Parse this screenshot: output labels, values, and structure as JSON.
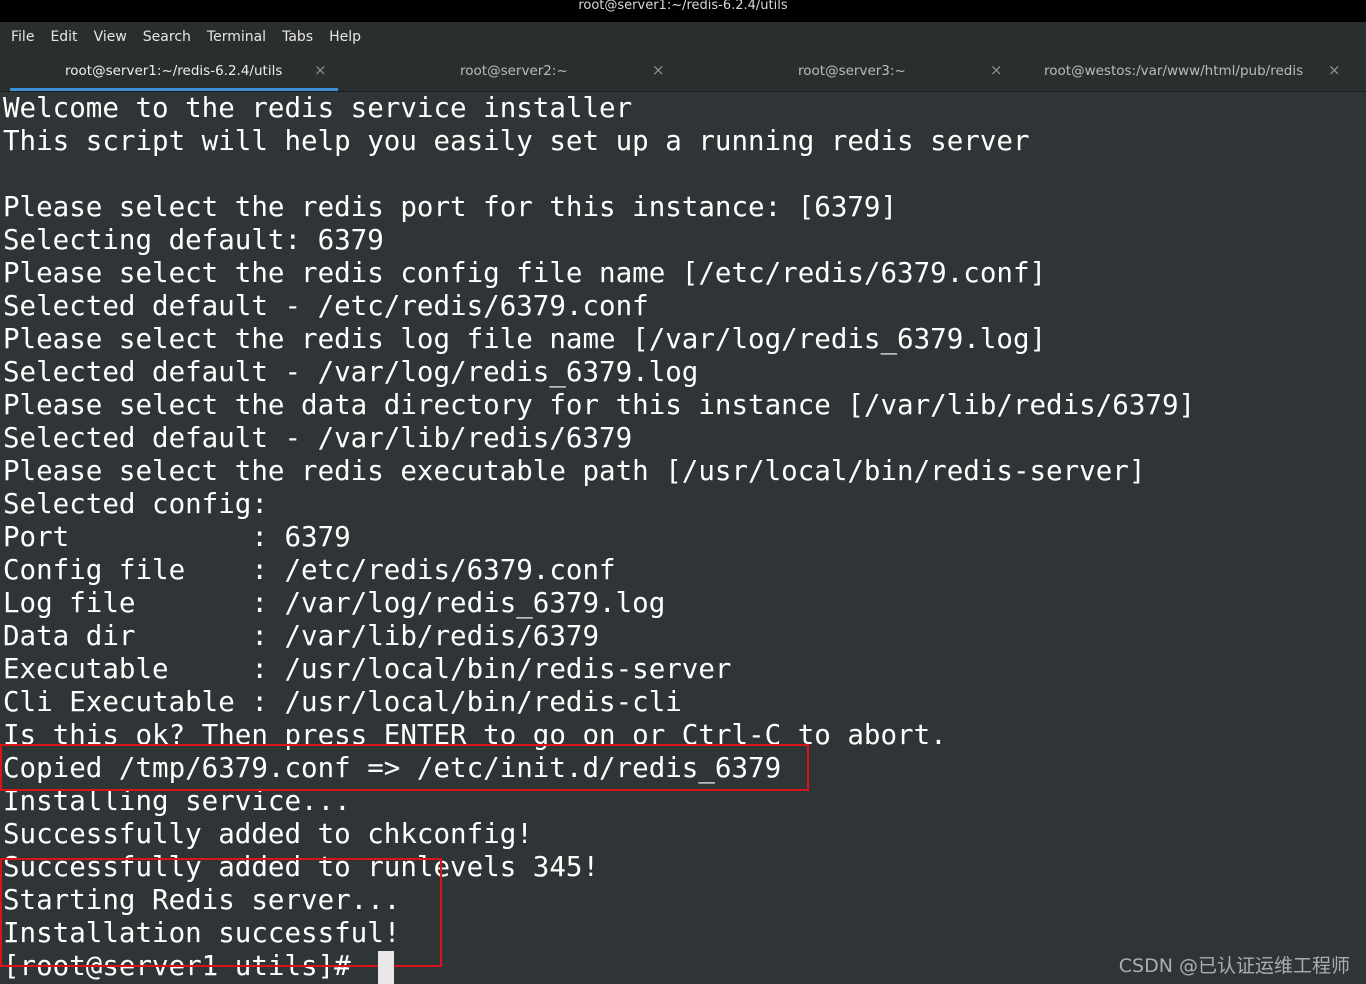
{
  "window": {
    "title": "root@server1:~/redis-6.2.4/utils"
  },
  "menu": [
    "File",
    "Edit",
    "View",
    "Search",
    "Terminal",
    "Tabs",
    "Help"
  ],
  "tabs": [
    {
      "label": "root@server1:~/redis-6.2.4/utils",
      "close": "×",
      "active": true
    },
    {
      "label": "root@server2:~",
      "close": "×",
      "active": false
    },
    {
      "label": "root@server3:~",
      "close": "×",
      "active": false
    },
    {
      "label": "root@westos:/var/www/html/pub/redis",
      "close": "×",
      "active": false
    }
  ],
  "terminal": {
    "lines": [
      "Welcome to the redis service installer",
      "This script will help you easily set up a running redis server",
      "",
      "Please select the redis port for this instance: [6379]",
      "Selecting default: 6379",
      "Please select the redis config file name [/etc/redis/6379.conf]",
      "Selected default - /etc/redis/6379.conf",
      "Please select the redis log file name [/var/log/redis_6379.log]",
      "Selected default - /var/log/redis_6379.log",
      "Please select the data directory for this instance [/var/lib/redis/6379]",
      "Selected default - /var/lib/redis/6379",
      "Please select the redis executable path [/usr/local/bin/redis-server]",
      "Selected config:",
      "Port           : 6379",
      "Config file    : /etc/redis/6379.conf",
      "Log file       : /var/log/redis_6379.log",
      "Data dir       : /var/lib/redis/6379",
      "Executable     : /usr/local/bin/redis-server",
      "Cli Executable : /usr/local/bin/redis-cli",
      "Is this ok? Then press ENTER to go on or Ctrl-C to abort.",
      "Copied /tmp/6379.conf => /etc/init.d/redis_6379",
      "Installing service...",
      "Successfully added to chkconfig!",
      "Successfully added to runlevels 345!",
      "Starting Redis server...",
      "Installation successful!",
      "[root@server1 utils]# "
    ]
  },
  "watermark": "CSDN @已认证运维工程师",
  "colors": {
    "terminal_bg": "#2f3536",
    "terminal_fg": "#ffffff",
    "tab_active_underline": "#3d8fd6",
    "highlight_box": "#d9151b"
  }
}
